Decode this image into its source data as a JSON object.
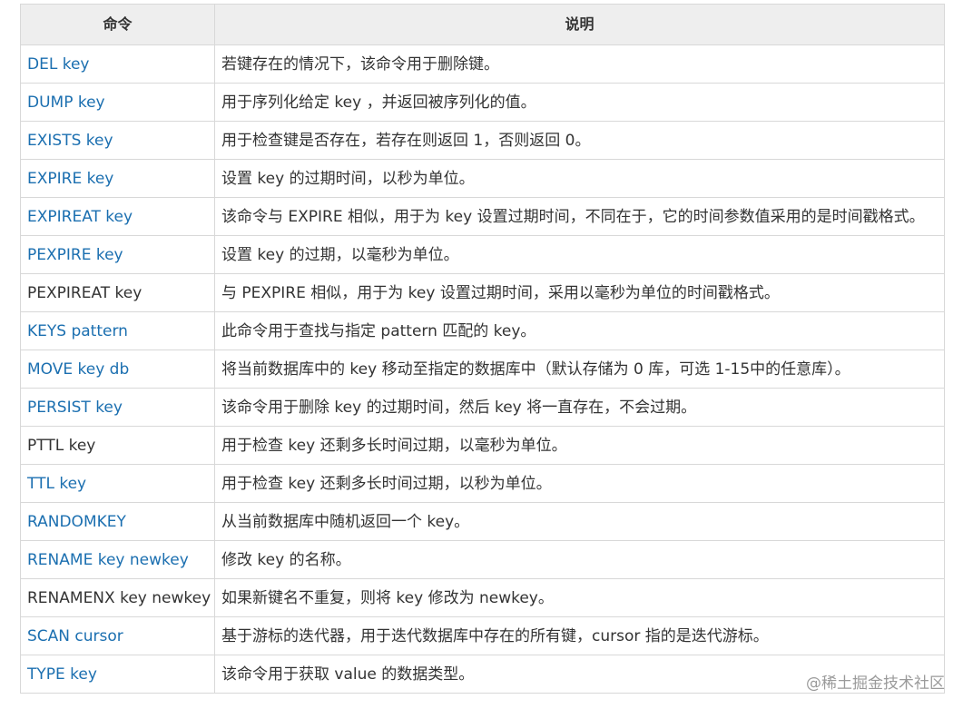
{
  "table": {
    "headers": {
      "command": "命令",
      "description": "说明"
    },
    "rows": [
      {
        "command": "DEL key",
        "description": "若键存在的情况下，该命令用于删除键。",
        "link": true
      },
      {
        "command": "DUMP key",
        "description": "用于序列化给定 key ，并返回被序列化的值。",
        "link": true
      },
      {
        "command": "EXISTS key",
        "description": "用于检查键是否存在，若存在则返回 1，否则返回 0。",
        "link": true
      },
      {
        "command": "EXPIRE key",
        "description": "设置 key 的过期时间，以秒为单位。",
        "link": true
      },
      {
        "command": "EXPIREAT key",
        "description": "该命令与 EXPIRE 相似，用于为 key 设置过期时间，不同在于，它的时间参数值采用的是时间戳格式。",
        "link": true
      },
      {
        "command": "PEXPIRE key",
        "description": "设置 key 的过期，以毫秒为单位。",
        "link": true
      },
      {
        "command": "PEXPIREAT key",
        "description": "与 PEXPIRE 相似，用于为 key 设置过期时间，采用以毫秒为单位的时间戳格式。",
        "link": false
      },
      {
        "command": "KEYS pattern",
        "description": "此命令用于查找与指定 pattern 匹配的 key。",
        "link": true
      },
      {
        "command": "MOVE key db",
        "description": "将当前数据库中的 key 移动至指定的数据库中（默认存储为 0 库，可选 1-15中的任意库）。",
        "link": true
      },
      {
        "command": "PERSIST key",
        "description": "该命令用于删除 key 的过期时间，然后 key 将一直存在，不会过期。",
        "link": true
      },
      {
        "command": "PTTL key",
        "description": "用于检查 key 还剩多长时间过期，以毫秒为单位。",
        "link": false
      },
      {
        "command": "TTL key",
        "description": "用于检查 key 还剩多长时间过期，以秒为单位。",
        "link": true
      },
      {
        "command": "RANDOMKEY",
        "description": "从当前数据库中随机返回一个 key。",
        "link": true
      },
      {
        "command": "RENAME key newkey",
        "description": "修改 key 的名称。",
        "link": true
      },
      {
        "command": "RENAMENX key newkey",
        "description": "如果新键名不重复，则将 key 修改为 newkey。",
        "link": false
      },
      {
        "command": "SCAN cursor",
        "description": "基于游标的迭代器，用于迭代数据库中存在的所有键，cursor 指的是迭代游标。",
        "link": true
      },
      {
        "command": "TYPE key",
        "description": "该命令用于获取 value 的数据类型。",
        "link": true
      }
    ]
  },
  "watermark": "@稀土掘金技术社区",
  "colors": {
    "link": "#1b6fb0",
    "text": "#333333",
    "header_bg": "#eeeeee",
    "border": "#d8d8d8"
  }
}
